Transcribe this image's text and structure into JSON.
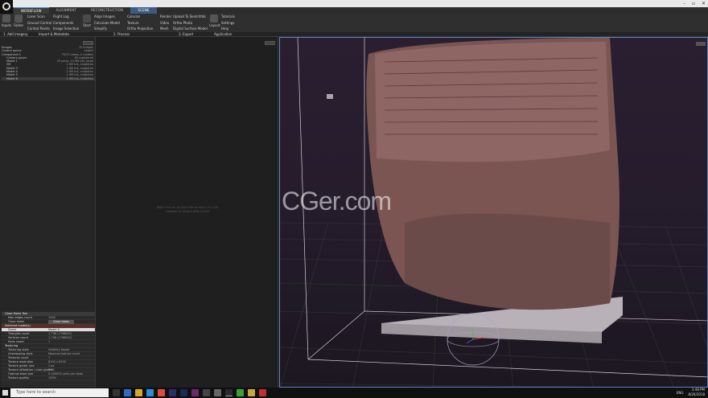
{
  "quick_access_colors": [
    "#6b8dc9",
    "#6b8dc9",
    "#6b8dc9"
  ],
  "window_controls": [
    "–",
    "▫",
    "✕"
  ],
  "tabs": [
    "WORKFLOW",
    "ALIGNMENT",
    "RECONSTRUCTION",
    "SCENE"
  ],
  "active_tab": "SCENE",
  "ribbon": {
    "inputs": "Inputs",
    "folder": "Folder",
    "col1": [
      "Laser Scan",
      "Ground Control",
      "Control Points"
    ],
    "col2": [
      "Flight Log",
      "Components",
      "Image Selection"
    ],
    "start": "Start",
    "col3": [
      "Align Images",
      "Calculate Model",
      "Simplify"
    ],
    "col4": [
      "Colorize",
      "Texture",
      "Ortho Projection"
    ],
    "col5": [
      "Render",
      "Video",
      "Mesh"
    ],
    "col6": [
      "Upload To Sketchfab",
      "Ortho Photo",
      "Digital Surface Model"
    ],
    "layout": "Layout",
    "col7": [
      "Tutorials",
      "Settings",
      "Help"
    ]
  },
  "sections": [
    "1. Add imagery",
    "Import & Metadata",
    "2. Process",
    "3. Export",
    "Application"
  ],
  "tree": [
    {
      "label": "Images",
      "value": "75 images"
    },
    {
      "label": "Control points",
      "value": "export"
    },
    {
      "label": "Component 0",
      "value": "75/75 views, 0 models"
    },
    {
      "label": "Camera poses",
      "value": "65 registered"
    },
    {
      "label": "Model 1",
      "value": "29 parts, 10.9M tris, large"
    },
    {
      "label": "3M",
      "value": "1.9M tris, singleton"
    },
    {
      "label": "Model 3",
      "value": "1.9M tris, singleton"
    },
    {
      "label": "Model 4",
      "value": "1.9M tris, singleton"
    },
    {
      "label": "Model 5",
      "value": "1.9M tris, singleton"
    },
    {
      "label": "Model 6",
      "value": "1.9M tris, singleton"
    }
  ],
  "center_hint": "Right click on an input file to view it in a 2D viewport or drag & drop it here",
  "watermark": "CGer.com",
  "props": {
    "tool_title": "Close Holes Tool",
    "tool_rows": [
      {
        "k": "Max edges count",
        "v": "1000"
      },
      {
        "k": "Close holes",
        "v": "Close holes"
      }
    ],
    "sel_title": "Selected model(s)",
    "sel_rows": [
      {
        "k": "Name",
        "v": "Model 6"
      },
      {
        "k": "Triangles count",
        "v": "1,798 (1798622)"
      },
      {
        "k": "Vertices count",
        "v": "1,796 (1796622)"
      },
      {
        "k": "Parts count",
        "v": "1"
      }
    ],
    "tex_title": "Texturing",
    "tex_rows": [
      {
        "k": "Texturing style",
        "v": "Visibility based"
      },
      {
        "k": "Unwrapping style",
        "v": "Maximal texture count"
      },
      {
        "k": "Textures count",
        "v": "1"
      },
      {
        "k": "Texture resolution",
        "v": "8192 x 8192"
      },
      {
        "k": "Texture gutter size",
        "v": "2 px"
      },
      {
        "k": "Texture utilization / color gradie",
        "v": "99%"
      },
      {
        "k": "Optimal texel size",
        "v": "0.000003 units per texel"
      },
      {
        "k": "Texture quality",
        "v": "100%"
      }
    ]
  },
  "taskbar": {
    "search": "Type here to search",
    "lang": "ENG",
    "time": "3:48 PM",
    "date": "8/26/2018"
  }
}
